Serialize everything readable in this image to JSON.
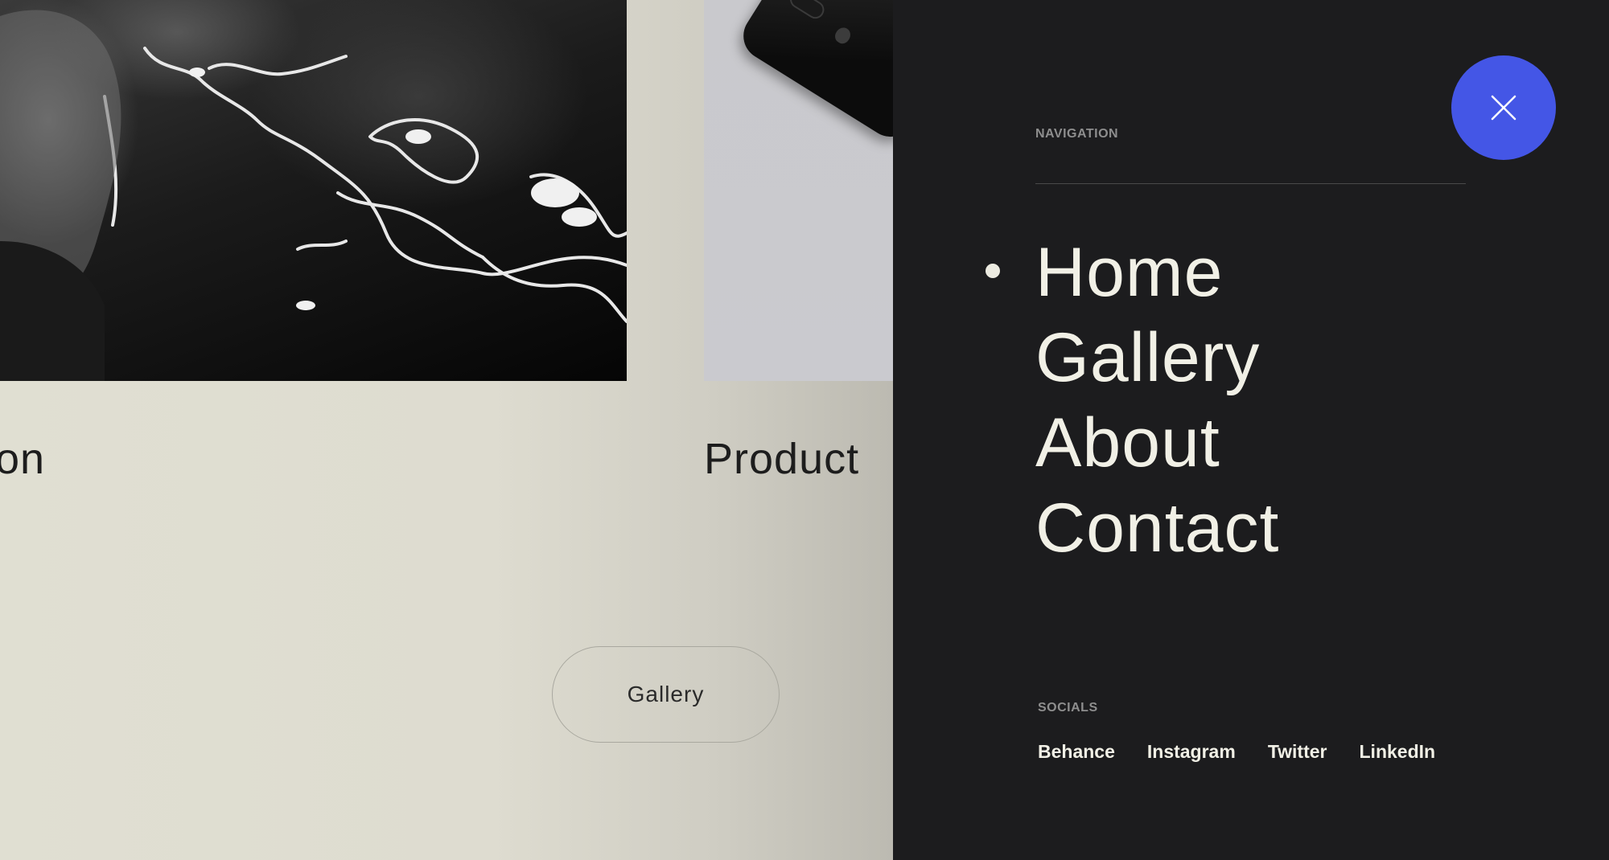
{
  "gallery": {
    "left_card_title": "on",
    "right_card_title": "Product",
    "gallery_button_label": "Gallery"
  },
  "nav": {
    "heading": "NAVIGATION",
    "items": [
      {
        "label": "Home",
        "active": true
      },
      {
        "label": "Gallery",
        "active": false
      },
      {
        "label": "About",
        "active": false
      },
      {
        "label": "Contact",
        "active": false
      }
    ],
    "close_icon": "close-icon"
  },
  "socials": {
    "heading": "SOCIALS",
    "links": [
      "Behance",
      "Instagram",
      "Twitter",
      "LinkedIn"
    ]
  },
  "colors": {
    "panel_bg": "#1c1c1e",
    "accent": "#4456e6",
    "page_bg": "#e0dfd3",
    "nav_text": "#f1f0e6"
  }
}
